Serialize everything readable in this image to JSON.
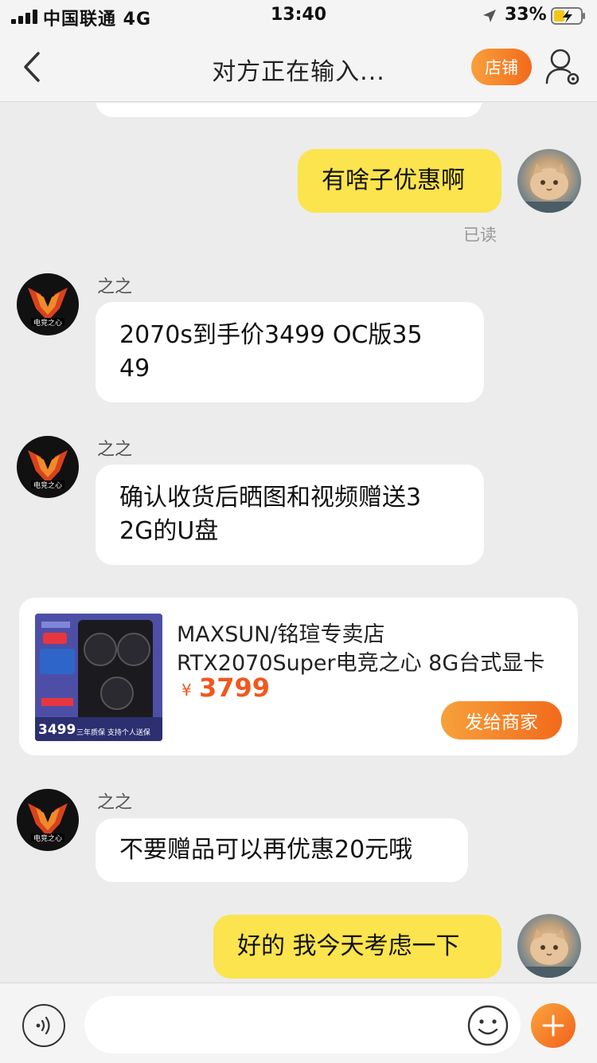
{
  "status_bar": {
    "carrier": "中国联通 4G",
    "time": "13:40",
    "battery": "33%"
  },
  "header": {
    "title": "对方正在输入...",
    "shop_button": "店铺"
  },
  "messages": [
    {
      "side": "right",
      "text": "有啥子优惠啊",
      "read_status": "已读"
    },
    {
      "side": "left",
      "sender": "之之",
      "line1": "2070s到手价3499  OC版35",
      "line2": "49"
    },
    {
      "side": "left",
      "sender": "之之",
      "line1": "确认收货后晒图和视频赠送3",
      "line2": "2G的U盘"
    },
    {
      "side": "left",
      "sender": "之之",
      "text": "不要赠品可以再优惠20元哦"
    },
    {
      "side": "right",
      "text": "好的 我今天考虑一下"
    }
  ],
  "product_card": {
    "store": "MAXSUN/铭瑄专卖店",
    "title": "RTX2070Super电竞之心 8G台式显卡",
    "currency": "¥",
    "price": "3799",
    "send_button": "发给商家",
    "image_price": "3499",
    "image_caption": "三年质保  支持个人送保"
  },
  "input": {
    "placeholder": ""
  },
  "colors": {
    "accent_orange": "#f26a1b",
    "my_bubble": "#fbe44d",
    "price": "#f2571e",
    "chat_bg": "#ececec"
  },
  "icons": [
    "signal-icon",
    "location-arrow-icon",
    "battery-charging-icon",
    "chevron-left-icon",
    "user-settings-icon",
    "voice-icon",
    "emoji-icon",
    "plus-icon"
  ]
}
